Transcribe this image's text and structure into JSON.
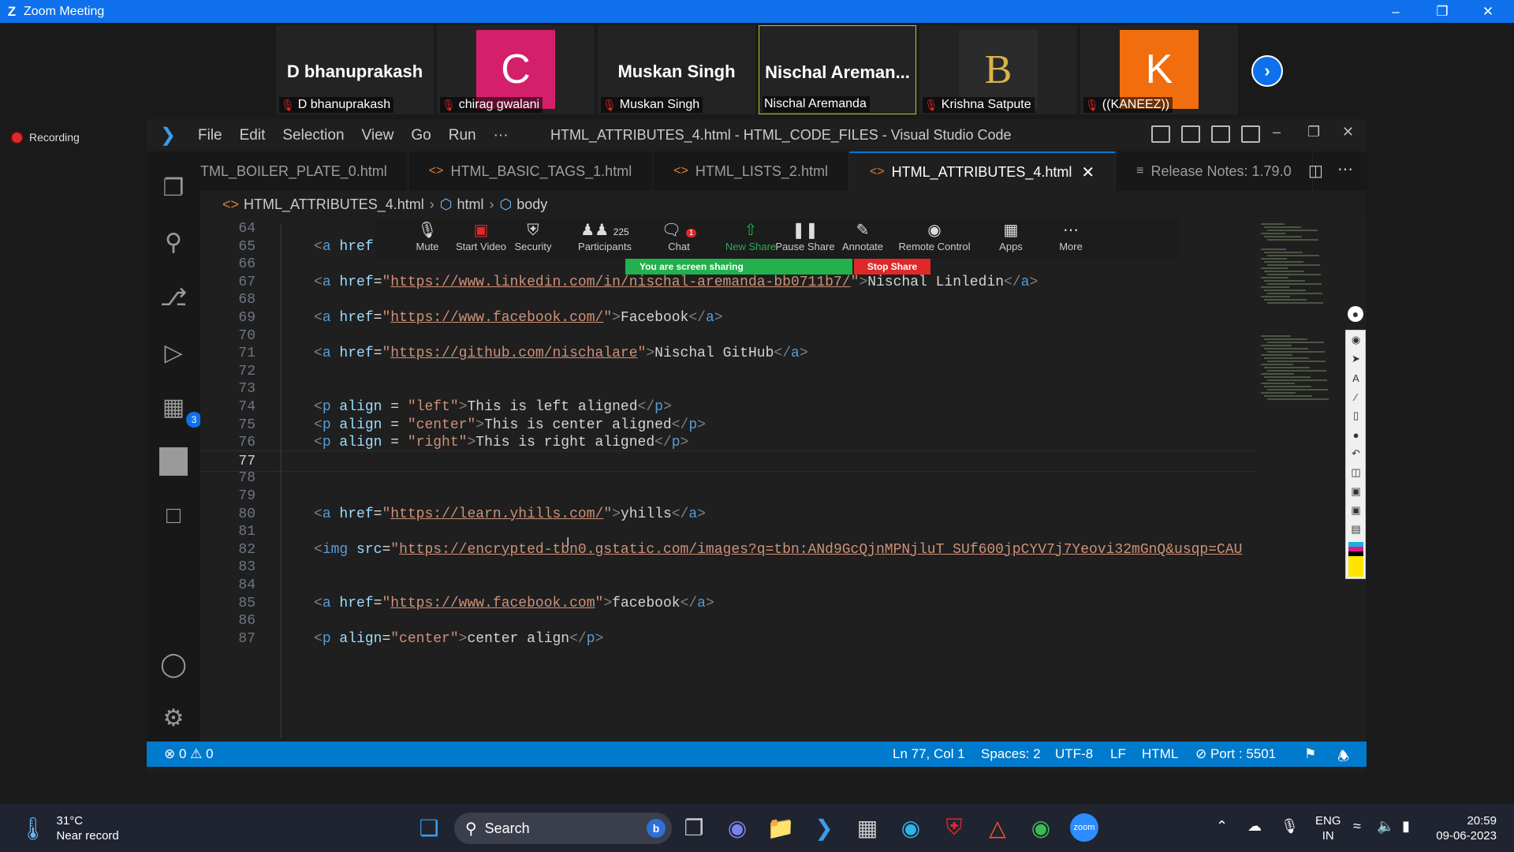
{
  "zoom": {
    "window_title": "Zoom Meeting",
    "recording_label": "Recording",
    "participants": [
      {
        "display": "D bhanuprakash",
        "label": "D bhanuprakash",
        "avatar_letter": "",
        "avatar_color": ""
      },
      {
        "display": "",
        "label": "chirag gwalani",
        "avatar_letter": "C",
        "avatar_color": "#d4206b"
      },
      {
        "display": "Muskan Singh",
        "label": "Muskan Singh",
        "avatar_letter": "",
        "avatar_color": ""
      },
      {
        "display": "Nischal  Areman...",
        "label": "Nischal Aremanda",
        "avatar_letter": "",
        "avatar_color": ""
      },
      {
        "display": "",
        "label": "Krishna Satpute",
        "avatar_letter": "B",
        "avatar_color": "#2b2b2b"
      },
      {
        "display": "",
        "label": "((KANEEZ))",
        "avatar_letter": "K",
        "avatar_color": "#f26d0e"
      }
    ],
    "toolbar": {
      "mute": "Mute",
      "start_video": "Start Video",
      "security": "Security",
      "participants": "Participants",
      "participants_count": "225",
      "chat": "Chat",
      "chat_badge": "1",
      "new_share": "New Share",
      "pause_share": "Pause Share",
      "annotate": "Annotate",
      "remote_control": "Remote Control",
      "apps": "Apps",
      "more": "More"
    },
    "sharing_text": "You are screen sharing",
    "stop_share": "Stop Share"
  },
  "vscode": {
    "menu": [
      "File",
      "Edit",
      "Selection",
      "View",
      "Go",
      "Run",
      "···"
    ],
    "window_title": "HTML_ATTRIBUTES_4.html - HTML_CODE_FILES - Visual Studio Code",
    "extensions_badge": "3",
    "tabs": [
      {
        "label": "TML_BOILER_PLATE_0.html",
        "icon": ""
      },
      {
        "label": "HTML_BASIC_TAGS_1.html",
        "icon": "<>"
      },
      {
        "label": "HTML_LISTS_2.html",
        "icon": "<>"
      },
      {
        "label": "HTML_ATTRIBUTES_4.html",
        "icon": "<>"
      },
      {
        "label": "Release Notes: 1.79.0",
        "icon": "≡"
      }
    ],
    "breadcrumb": [
      "HTML_ATTRIBUTES_4.html",
      "html",
      "body"
    ],
    "line_numbers": [
      "64",
      "65",
      "66",
      "67",
      "68",
      "69",
      "70",
      "71",
      "72",
      "73",
      "74",
      "75",
      "76",
      "77",
      "78",
      "79",
      "80",
      "81",
      "82",
      "83",
      "84",
      "85",
      "86",
      "87"
    ],
    "status": {
      "errors": "0",
      "warnings": "0",
      "position": "Ln 77, Col 1",
      "spaces": "Spaces: 2",
      "encoding": "UTF-8",
      "eol": "LF",
      "language": "HTML",
      "port": "Port : 5501"
    }
  },
  "taskbar": {
    "temperature": "31°C",
    "weather_text": "Near record",
    "search": "Search",
    "lang_1": "ENG",
    "lang_2": "IN",
    "time": "20:59",
    "date": "09-06-2023"
  }
}
